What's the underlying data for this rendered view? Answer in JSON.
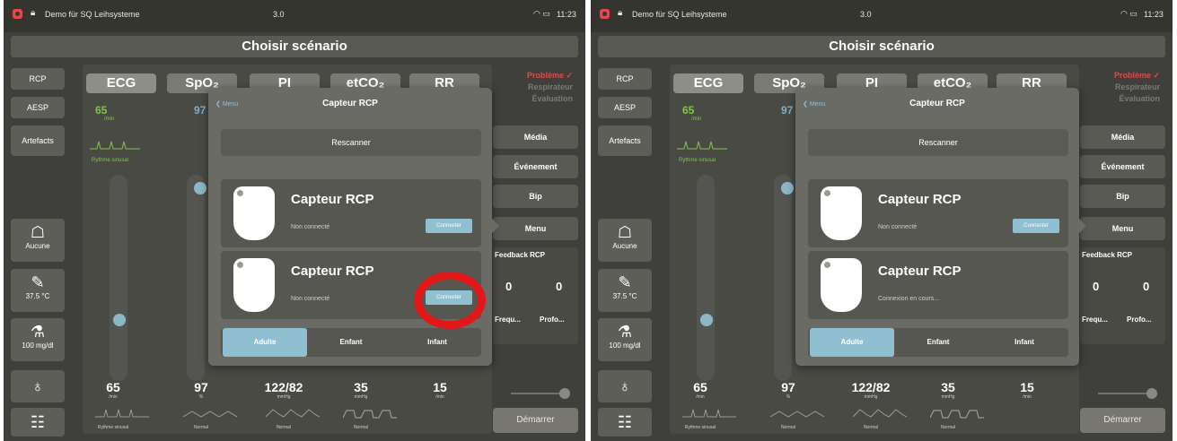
{
  "panels": [
    {
      "status": {
        "app_title": "Demo für SQ Leihsysteme",
        "version": "3.0",
        "time": "11:23"
      },
      "title": "Choisir scénario",
      "left_buttons": {
        "rcp": "RCP",
        "aesp": "AESP",
        "artefacts": "Artefacts",
        "ventilation": "Aucune",
        "temperature": "37.5 °C",
        "glucose": "100 mg/dl"
      },
      "tabs": [
        "ECG",
        "SpO₂",
        "PI",
        "etCO₂",
        "RR"
      ],
      "ecg": {
        "hr": "65",
        "hr_unit": "/min",
        "rhythm": "Rythme sinusal",
        "spo2": "97"
      },
      "right": {
        "alert": "Problème ✓",
        "resp": "Respirateur",
        "eval": "Évaluation",
        "media": "Média",
        "event": "Événement",
        "bip": "Bip",
        "menu": "Menu"
      },
      "feedback": {
        "title": "Feedback RCP",
        "freq_value": "0",
        "depth_value": "0",
        "freq_label": "Frequ...",
        "depth_label": "Profo..."
      },
      "vitals": [
        {
          "value": "65",
          "unit": "/min",
          "sub": "Rythme sinusal"
        },
        {
          "value": "97",
          "unit": "%",
          "sub": "Normal"
        },
        {
          "value": "122/82",
          "unit": "mmHg",
          "sub": "Normal"
        },
        {
          "value": "35",
          "unit": "mmHg",
          "sub": "Normal"
        },
        {
          "value": "15",
          "unit": "/min",
          "sub": ""
        }
      ],
      "start": "Démarrer",
      "popup": {
        "back": "Menu",
        "title": "Capteur RCP",
        "rescan": "Rescanner",
        "devices": [
          {
            "name": "Capteur RCP",
            "state": "Non connecté",
            "connect": "Connecter"
          },
          {
            "name": "Capteur RCP",
            "state": "Non connecté",
            "connect": "Connecter"
          }
        ],
        "segments": [
          "Adulte",
          "Enfant",
          "Infant"
        ]
      }
    },
    {
      "status": {
        "app_title": "Demo für SQ Leihsysteme",
        "version": "3.0",
        "time": "11:23"
      },
      "title": "Choisir scénario",
      "left_buttons": {
        "rcp": "RCP",
        "aesp": "AESP",
        "artefacts": "Artefacts",
        "ventilation": "Aucune",
        "temperature": "37.5 °C",
        "glucose": "100 mg/dl"
      },
      "tabs": [
        "ECG",
        "SpO₂",
        "PI",
        "etCO₂",
        "RR"
      ],
      "ecg": {
        "hr": "65",
        "hr_unit": "/min",
        "rhythm": "Rythme sinusal",
        "spo2": "97"
      },
      "right": {
        "alert": "Problème ✓",
        "resp": "Respirateur",
        "eval": "Évaluation",
        "media": "Média",
        "event": "Événement",
        "bip": "Bip",
        "menu": "Menu"
      },
      "feedback": {
        "title": "Feedback RCP",
        "freq_value": "0",
        "depth_value": "0",
        "freq_label": "Frequ...",
        "depth_label": "Profo..."
      },
      "vitals": [
        {
          "value": "65",
          "unit": "/min",
          "sub": "Rythme sinusal"
        },
        {
          "value": "97",
          "unit": "%",
          "sub": "Normal"
        },
        {
          "value": "122/82",
          "unit": "mmHg",
          "sub": "Normal"
        },
        {
          "value": "35",
          "unit": "mmHg",
          "sub": "Normal"
        },
        {
          "value": "15",
          "unit": "/min",
          "sub": ""
        }
      ],
      "start": "Démarrer",
      "popup": {
        "back": "Menu",
        "title": "Capteur RCP",
        "rescan": "Rescanner",
        "devices": [
          {
            "name": "Capteur RCP",
            "state": "Non connecté",
            "connect": "Connecter"
          },
          {
            "name": "Capteur RCP",
            "state": "Connexion en cours...",
            "connect": ""
          }
        ],
        "segments": [
          "Adulte",
          "Enfant",
          "Infant"
        ]
      }
    }
  ],
  "colors": {
    "accent": "#8fbfd1",
    "ecg_green": "#7ec645",
    "alert_red": "#e04a4a",
    "highlight": "#e01818"
  },
  "icons": [
    "lock-icon",
    "wifi-icon",
    "battery-icon",
    "ventilation-icon",
    "thermometer-icon",
    "glucose-icon",
    "stethoscope-icon",
    "options-icon",
    "device-icon",
    "chevron-left-icon"
  ]
}
